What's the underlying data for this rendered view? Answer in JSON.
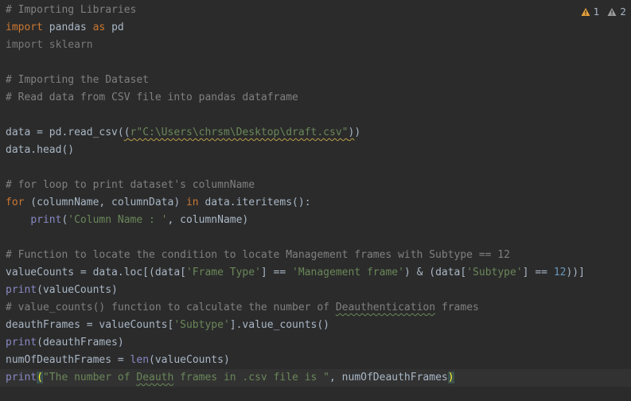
{
  "inspections": {
    "warnings": {
      "icon": "warning-triangle-icon",
      "count": "1",
      "color": "#e5a13a"
    },
    "weak_warnings": {
      "icon": "weak-warning-triangle-icon",
      "count": "2",
      "color": "#9c9c9c"
    }
  },
  "code": {
    "l1": "# Importing Libraries",
    "l2_kw1": "import",
    "l2_mod": " pandas ",
    "l2_kw2": "as",
    "l2_alias": " pd",
    "l3": "import sklearn",
    "l5": "# Importing the Dataset",
    "l6": "# Read data from CSV file into pandas dataframe",
    "l8_a": "data = pd.read_csv(",
    "l8_p1": "(",
    "l8_s": "r\"C:\\Users\\chrsm\\Desktop\\draft.csv\"",
    "l8_p2": ")",
    "l8_b": ")",
    "l9": "data.head()",
    "l11": "# for loop to print dataset's columnName",
    "l12_kw1": "for",
    "l12_a": " (columnName, columnData) ",
    "l12_kw2": "in",
    "l12_b": " data.iteritems():",
    "l13_indent": "    ",
    "l13_fn": "print",
    "l13_a": "(",
    "l13_s": "'Column Name : '",
    "l13_b": ", columnName)",
    "l15": "# Function to locate the condition to locate Management frames with Subtype == 12",
    "l16_a": "valueCounts = data.loc[(data[",
    "l16_s1": "'Frame Type'",
    "l16_b": "] == ",
    "l16_s2": "'Management frame'",
    "l16_c": ") & (data[",
    "l16_s3": "'Subtype'",
    "l16_d": "] == ",
    "l16_n": "12",
    "l16_e": "))]",
    "l17_fn": "print",
    "l17_a": "(valueCounts)",
    "l18_a": "# value_counts() function to calculate the number of ",
    "l18_w": "Deauthentication",
    "l18_b": " frames",
    "l19_a": "deauthFrames = valueCounts[",
    "l19_s": "'Subtype'",
    "l19_b": "].value_counts()",
    "l20_fn": "print",
    "l20_a": "(deauthFrames)",
    "l21_a": "numOfDeauthFrames = ",
    "l21_fn": "len",
    "l21_b": "(valueCounts)",
    "l22_fn": "print",
    "l22_p1": "(",
    "l22_s1": "\"The number of ",
    "l22_w": "Deauth",
    "l22_s2": " frames in .csv file is \"",
    "l22_b": ", numOfDeauthFrames",
    "l22_p2": ")"
  }
}
